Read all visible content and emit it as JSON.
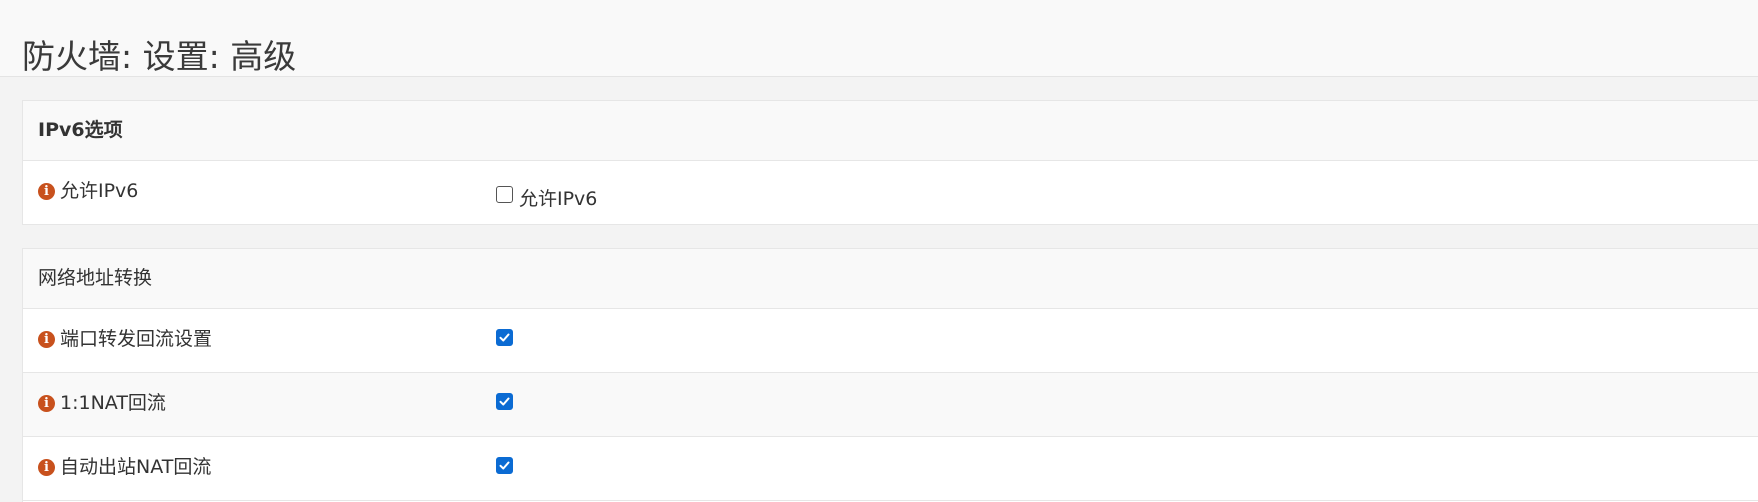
{
  "page": {
    "title": "防火墙: 设置: 高级"
  },
  "ipv6_section": {
    "heading": "IPv6选项",
    "rows": [
      {
        "label": "允许IPv6",
        "checkbox_label": "允许IPv6",
        "checked": false
      }
    ]
  },
  "nat_section": {
    "heading": "网络地址转换",
    "rows": [
      {
        "label": "端口转发回流设置",
        "checked": true
      },
      {
        "label": "1:1NAT回流",
        "checked": true
      },
      {
        "label": "自动出站NAT回流",
        "checked": true
      }
    ]
  },
  "icons": {
    "info": "info-icon",
    "check": "check-icon"
  },
  "colors": {
    "info_icon": "#c8511d",
    "checkbox_checked": "#0b6bd3",
    "header_bg": "#f9f9f9",
    "page_bg": "#f3f3f3"
  }
}
